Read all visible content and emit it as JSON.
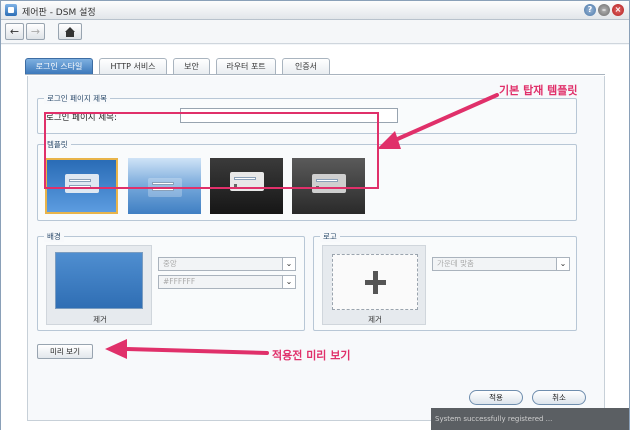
{
  "window": {
    "title": "제어판 - DSM 설정",
    "icons": [
      "app-icon",
      "help-icon",
      "minimize-icon",
      "close-icon"
    ]
  },
  "toolbar": {
    "back_icon": "arrow-left-icon",
    "forward_icon": "arrow-right-icon",
    "home_icon": "home-icon"
  },
  "tabs": [
    {
      "label": "로그인 스타일",
      "active": true
    },
    {
      "label": "HTTP 서비스",
      "active": false
    },
    {
      "label": "보안",
      "active": false
    },
    {
      "label": "라우터 포트",
      "active": false
    },
    {
      "label": "인증서",
      "active": false
    }
  ],
  "login_title_group": {
    "legend": "로그인 페이지 제목",
    "field_label": "로그인 페이지 제목:",
    "field_value": ""
  },
  "template_group": {
    "legend": "템플릿",
    "selected_index": 0
  },
  "background_group": {
    "legend": "배경",
    "remove_label": "제거",
    "position_select": "중앙",
    "color_select": "#FFFFFF"
  },
  "logo_group": {
    "legend": "로고",
    "remove_label": "제거",
    "align_select": "가운데 맞춤"
  },
  "buttons": {
    "preview": "미리 보기",
    "apply": "적용",
    "cancel": "취소"
  },
  "annotations": {
    "template_note": "기본 탑재 템플릿",
    "preview_note": "적용전 미리 보기",
    "accent_color": "#e0306a"
  },
  "background_window_text": "System successfully registered ..."
}
